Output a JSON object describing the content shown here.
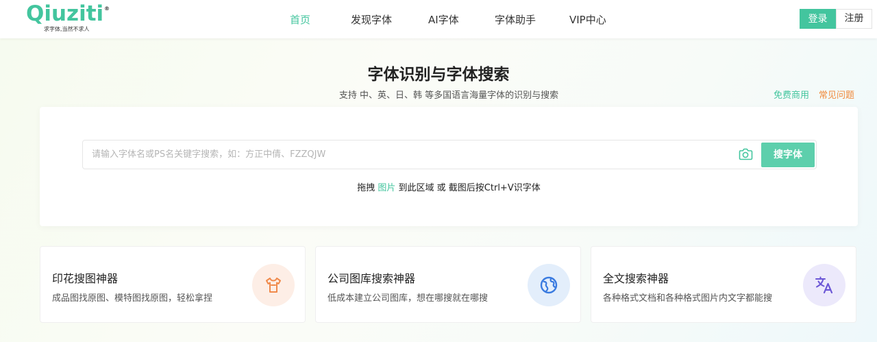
{
  "brand": {
    "logo_text": "Qiuziti",
    "registered_mark": "®",
    "tagline": "求字体,当然不求人",
    "accent_color": "#43c59e"
  },
  "nav": {
    "items": [
      {
        "label": "首页",
        "active": true
      },
      {
        "label": "发现字体",
        "active": false
      },
      {
        "label": "AI字体",
        "active": false
      },
      {
        "label": "字体助手",
        "active": false
      },
      {
        "label": "VIP中心",
        "active": false
      }
    ]
  },
  "auth": {
    "login_label": "登录",
    "register_label": "注册"
  },
  "hero": {
    "title": "字体识别与字体搜索",
    "subtitle": "支持 中、英、日、韩 等多国语言海量字体的识别与搜索",
    "free_commercial_link": "免费商用",
    "faq_link": "常见问题",
    "faq_color": "#f08a3c"
  },
  "search": {
    "placeholder": "请输入字体名或PS名关键字搜索，如：方正中倩、FZZQJW",
    "value": "",
    "camera_icon": "camera-icon",
    "button_label": "搜字体",
    "hint_before": "拖拽 ",
    "hint_highlight": "图片",
    "hint_after": " 到此区域 或 截图后按Ctrl+V识字体"
  },
  "features": [
    {
      "title": "印花搜图神器",
      "desc": "成品图找原图、模特图找原图，轻松拿捏",
      "icon": "tshirt-icon",
      "icon_bg": "#fdeee6",
      "icon_color": "#f08a4b"
    },
    {
      "title": "公司图库搜索神器",
      "desc": "低成本建立公司图库，想在哪搜就在哪搜",
      "icon": "globe-icon",
      "icon_bg": "#e3eefb",
      "icon_color": "#3a7be0"
    },
    {
      "title": "全文搜索神器",
      "desc": "各种格式文档和各种格式图片内文字都能搜",
      "icon": "translate-icon",
      "icon_bg": "#ece9fb",
      "icon_color": "#6b56d6"
    }
  ]
}
